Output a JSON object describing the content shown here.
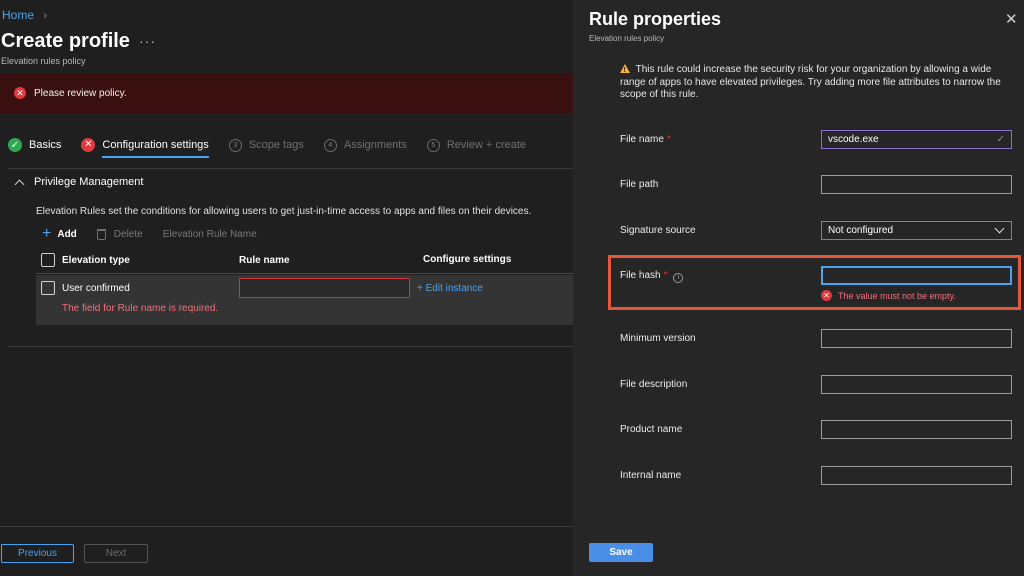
{
  "breadcrumb": {
    "home": "Home",
    "separator": "›"
  },
  "page": {
    "title": "Create profile",
    "subtitle": "Elevation rules policy",
    "more": "···"
  },
  "banner": {
    "message": "Please review policy."
  },
  "steps": [
    {
      "label": "Basics",
      "status": "done"
    },
    {
      "label": "Configuration settings",
      "status": "error"
    },
    {
      "number": "3",
      "label": "Scope tags",
      "status": "pending"
    },
    {
      "number": "4",
      "label": "Assignments",
      "status": "pending"
    },
    {
      "number": "5",
      "label": "Review + create",
      "status": "pending"
    }
  ],
  "section": {
    "title": "Privilege Management",
    "description": "Elevation Rules set the conditions for allowing users to get just-in-time access to apps and files on their devices."
  },
  "toolbar": {
    "add": "Add",
    "delete": "Delete",
    "filter_placeholder": "Elevation Rule Name"
  },
  "table": {
    "headers": [
      "Elevation type",
      "Rule name",
      "Configure settings"
    ],
    "row": {
      "elevation_type": "User confirmed",
      "rule_name": "",
      "edit_link": "+ Edit instance",
      "error": "The field for Rule name is required."
    }
  },
  "footer": {
    "previous": "Previous",
    "next": "Next"
  },
  "panel": {
    "title": "Rule properties",
    "subtitle": "Elevation rules policy",
    "warning": "This rule could increase the security risk for your organization by allowing a wide range of apps to have elevated privileges. Try adding more file attributes to narrow the scope of this rule.",
    "fields": {
      "file_name": {
        "label": "File name",
        "value": "vscode.exe",
        "required": "*"
      },
      "file_path": {
        "label": "File path",
        "value": ""
      },
      "signature_source": {
        "label": "Signature source",
        "value": "Not configured"
      },
      "file_hash": {
        "label": "File hash",
        "value": "",
        "required": "*",
        "info": "i",
        "error": "The value must not be empty."
      },
      "minimum_version": {
        "label": "Minimum version",
        "value": ""
      },
      "file_description": {
        "label": "File description",
        "value": ""
      },
      "product_name": {
        "label": "Product name",
        "value": ""
      },
      "internal_name": {
        "label": "Internal name",
        "value": ""
      }
    },
    "save": "Save"
  },
  "colors": {
    "accent": "#4aa3f0",
    "error": "#e0393e",
    "highlight": "#e4573d",
    "success": "#2fa84f",
    "warning": "#f8b23b"
  },
  "icons": [
    "chevron-right-icon",
    "more-icon",
    "error-icon",
    "check-icon",
    "plus-icon",
    "trash-icon",
    "chevron-up-icon",
    "close-icon",
    "warning-icon",
    "info-icon",
    "chevron-down-icon",
    "checkmark-icon"
  ]
}
